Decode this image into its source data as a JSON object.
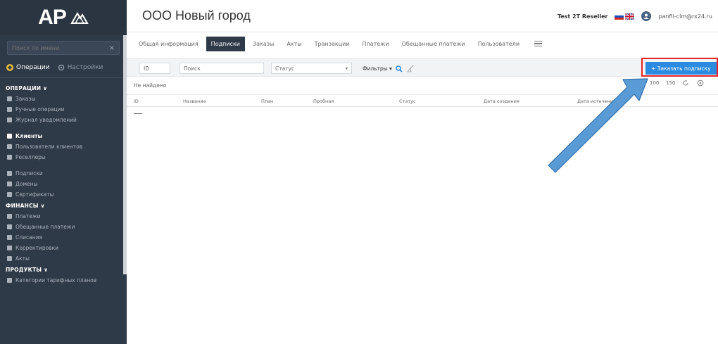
{
  "app": {
    "logo_text": "AP",
    "page_title": "ООО Новый город"
  },
  "header": {
    "reseller": "Test 2T Reseller",
    "user_email": "panfil-clm@rx24.ru"
  },
  "sidebar": {
    "search_placeholder": "Поиск по имени",
    "tabs": [
      {
        "label": "Операции",
        "active": true
      },
      {
        "label": "Настройки",
        "active": false
      }
    ],
    "sections": [
      {
        "title": "ОПЕРАЦИИ ∨",
        "items": [
          "Заказы",
          "Ручные операции",
          "Журнал уведомлений"
        ]
      },
      {
        "title": "",
        "items": [
          "Клиенты",
          "Пользователи клиентов",
          "Реселлеры"
        ]
      },
      {
        "title": "",
        "items": [
          "Подписки",
          "Домены",
          "Сертификаты"
        ]
      },
      {
        "title": "ФИНАНСЫ ∨",
        "items": [
          "Платежи",
          "Обещанные платежи",
          "Списания",
          "Корректировки",
          "Акты"
        ]
      },
      {
        "title": "ПРОДУКТЫ ∨",
        "items": [
          "Категории тарифных планов"
        ]
      }
    ]
  },
  "tabs": [
    {
      "label": "Общая информация",
      "active": false
    },
    {
      "label": "Подписки",
      "active": true
    },
    {
      "label": "Заказы",
      "active": false
    },
    {
      "label": "Акты",
      "active": false
    },
    {
      "label": "Транзакции",
      "active": false
    },
    {
      "label": "Платежи",
      "active": false
    },
    {
      "label": "Обещанные платежи",
      "active": false
    },
    {
      "label": "Пользователи",
      "active": false
    }
  ],
  "toolbar": {
    "id_placeholder": "ID",
    "search_placeholder": "Поиск",
    "status_placeholder": "Статус",
    "filters_label": "Фильтры ▾",
    "add_button": "+ Заказать подписку"
  },
  "table": {
    "empty_text": "Не найдено",
    "pager": [
      "50",
      "100",
      "150"
    ],
    "columns": [
      "ID",
      "Название",
      "План",
      "Пробная",
      "Статус",
      "Дата создания",
      "Дата истечения"
    ],
    "placeholder_row": "—"
  },
  "colors": {
    "sidebar_bg": "#2f3a48",
    "accent_blue": "#2a8be0",
    "highlight_red": "#e5262a",
    "arrow_fill": "#5b9bd5"
  }
}
